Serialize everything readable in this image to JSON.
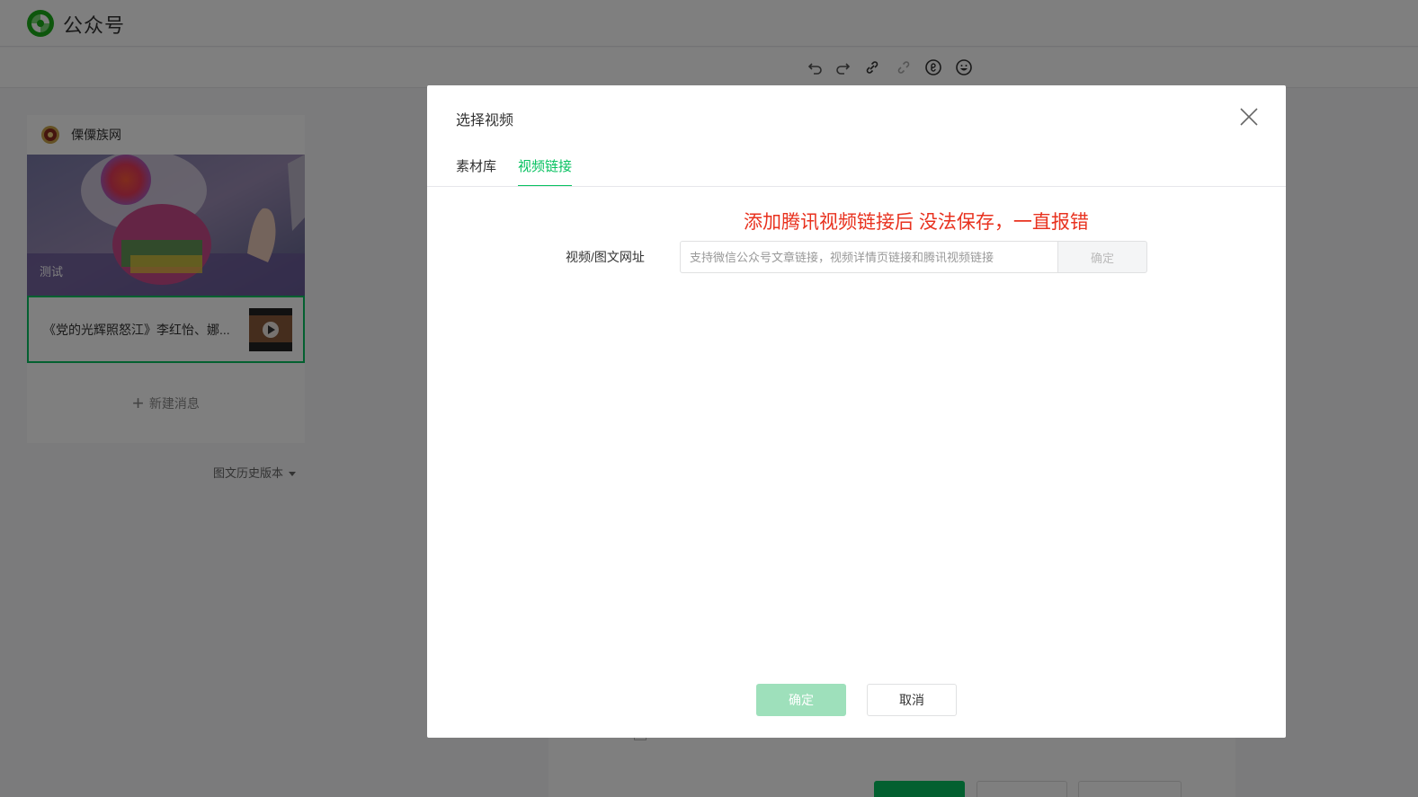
{
  "header": {
    "brand": "公众号"
  },
  "account": {
    "name": "傈僳族网"
  },
  "articles": {
    "cover_caption": "测试",
    "sub_title": "《党的光辉照怒江》李红怡、娜...",
    "new_message": "新建消息",
    "history": "图文历史版本"
  },
  "toolbar": {
    "icons": [
      "undo-icon",
      "redo-icon",
      "link-icon",
      "unlink-icon",
      "mini-program-icon",
      "emoji-icon"
    ]
  },
  "dialog": {
    "title": "选择视频",
    "tabs": [
      {
        "label": "素材库",
        "active": false
      },
      {
        "label": "视频链接",
        "active": true
      }
    ],
    "annotation": "添加腾讯视频链接后  没法保存，一直报错",
    "field_label": "视频/图文网址",
    "url_placeholder": "支持微信公众号文章链接，视频详情页链接和腾讯视频链接",
    "url_value": "",
    "url_confirm": "确定",
    "ok": "确定",
    "cancel": "取消"
  },
  "colors": {
    "accent": "#07c160",
    "annotation": "#e8321f",
    "disabled_ok": "#9ee0bb"
  }
}
